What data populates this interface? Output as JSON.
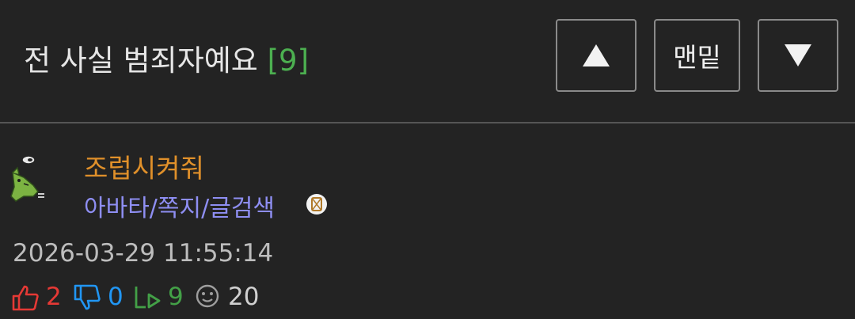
{
  "header": {
    "title": "전 사실 범죄자예요",
    "comment_count": "[9]",
    "up_label": "▲",
    "bottom_label": "맨밑",
    "down_label": "▼"
  },
  "author": {
    "name": "조럽시켜줘",
    "links": "아바타/쪽지/글검색"
  },
  "post": {
    "datetime": "2026-03-29 11:55:14"
  },
  "stats": {
    "likes": "2",
    "dislikes": "0",
    "shares": "9",
    "views": "20"
  },
  "colors": {
    "background": "#232323",
    "count_green": "#4caf50",
    "author_orange": "#e0902a",
    "link_purple": "#8e8ef2",
    "like_red": "#e53935",
    "dislike_blue": "#2196f3",
    "share_green": "#43a047"
  },
  "icons": [
    "thumbs-up-icon",
    "thumbs-down-icon",
    "reply-arrow-icon",
    "smiley-icon",
    "badge-icon"
  ]
}
